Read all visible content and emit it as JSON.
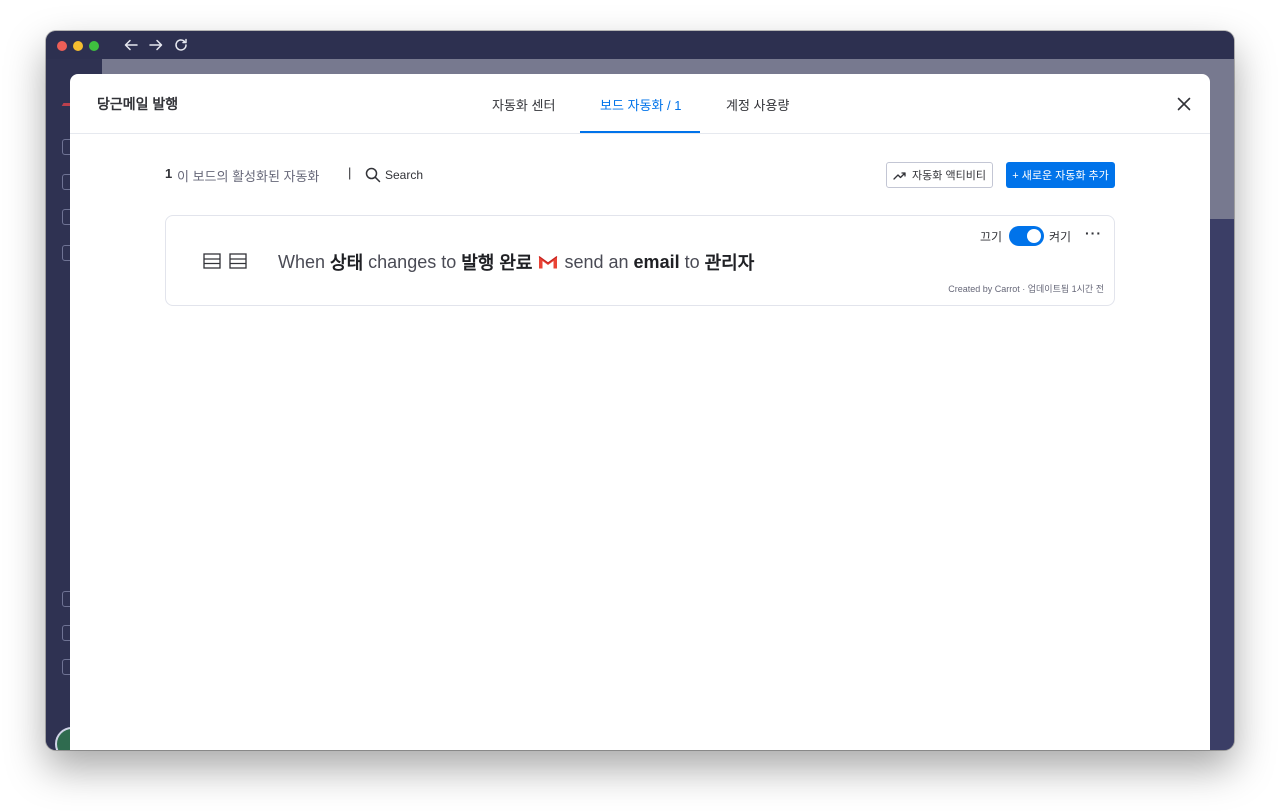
{
  "modal": {
    "title": "당근메일 발행",
    "tabs": [
      {
        "label": "자동화 센터"
      },
      {
        "label": "보드 자동화 / 1",
        "active": true
      },
      {
        "label": "계정 사용량"
      }
    ]
  },
  "toolbar": {
    "count": "1",
    "count_label": "이 보드의 활성화된 자동화",
    "separator": "|",
    "search_label": "Search",
    "activity_button": "자동화 액티비티",
    "add_button": "+ 새로운 자동화 추가"
  },
  "automation": {
    "when": "When",
    "column": "상태",
    "changes_to": "changes to",
    "status_value": "발행 완료",
    "send_an": "send an",
    "email": "email",
    "to": "to",
    "recipient": "관리자",
    "toggle_off_label": "끄기",
    "toggle_on_label": "켜기",
    "toggle_state": "on",
    "more": "···",
    "meta": "Created by Carrot · 업데이트됨 1시간 전"
  },
  "colors": {
    "accent": "#0073ea",
    "window_chrome": "#2d3050",
    "gmail_red": "#ea4335"
  }
}
